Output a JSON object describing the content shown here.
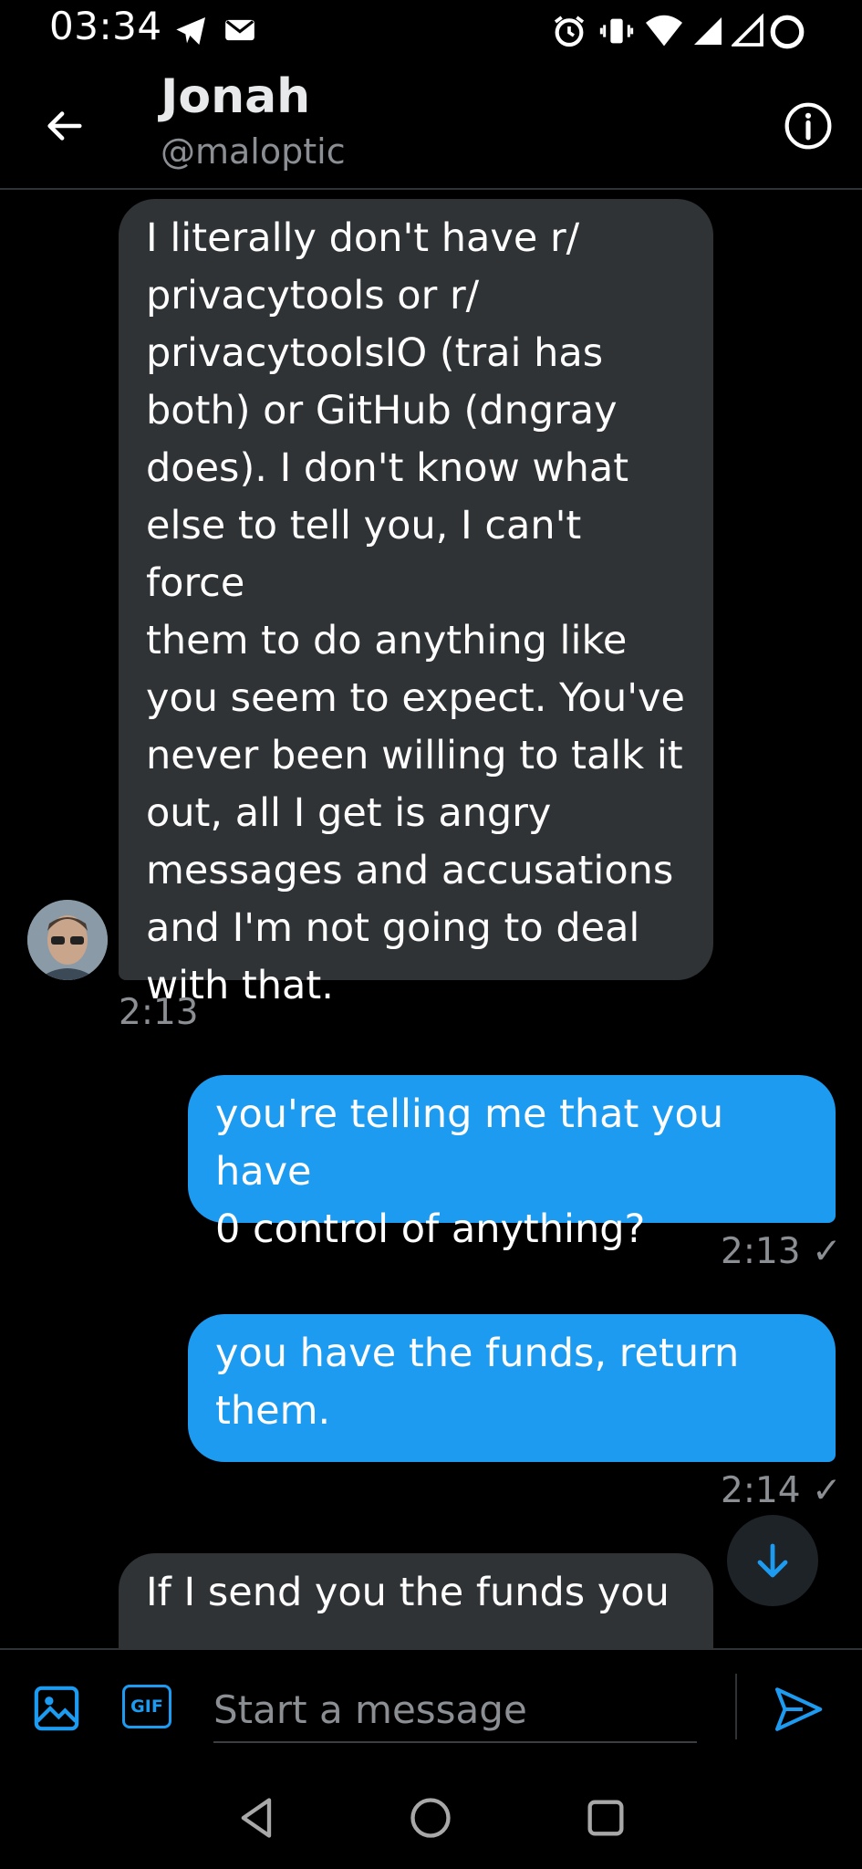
{
  "status_bar": {
    "time": "03:34"
  },
  "header": {
    "name": "Jonah",
    "handle": "@maloptic"
  },
  "messages": [
    {
      "direction": "received",
      "text": "I literally don't have r/\nprivacytools or r/\nprivacytoolsIO (trai has\nboth) or GitHub (dngray\ndoes). I don't know what\nelse to tell you, I can't force\nthem to do anything like\nyou seem to expect. You've\nnever been willing to talk it\nout, all I get is angry\nmessages and accusations\nand I'm not going to deal\nwith that.",
      "time": "2:13"
    },
    {
      "direction": "sent",
      "text": "you're telling me that you have\n0 control of anything?",
      "time": "2:13 ✓"
    },
    {
      "direction": "sent",
      "text": "you have the funds, return\nthem.",
      "time": "2:14 ✓"
    },
    {
      "direction": "received",
      "text": "If I send you the funds you",
      "time": ""
    }
  ],
  "composer": {
    "placeholder": "Start a message",
    "gif_label": "GIF"
  },
  "colors": {
    "accent": "#1d9bf0",
    "received_bubble": "#2f3336",
    "background": "#000000",
    "muted_text": "#8b8f94"
  },
  "icons": [
    "back-arrow-icon",
    "info-icon",
    "image-icon",
    "gif-icon",
    "send-icon",
    "scroll-down-icon",
    "nav-back-icon",
    "nav-home-icon",
    "nav-recents-icon"
  ]
}
